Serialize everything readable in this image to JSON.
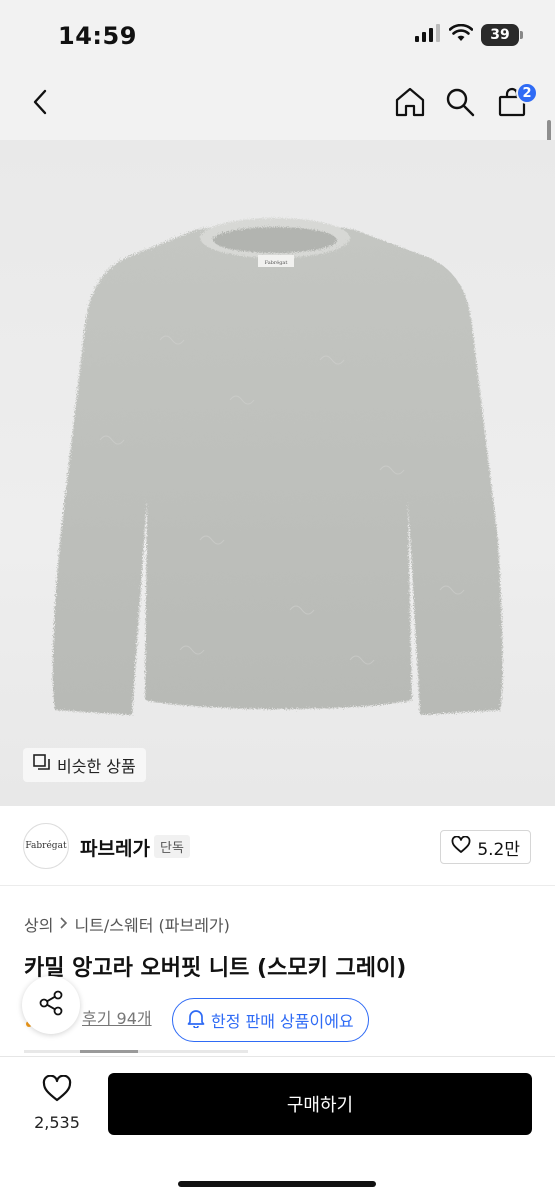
{
  "status_bar": {
    "time": "14:59",
    "battery": "39",
    "icons": [
      "cellular-signal-icon",
      "wifi-icon",
      "battery-icon"
    ]
  },
  "nav": {
    "icons": [
      "back-chevron-icon",
      "home-icon",
      "search-icon",
      "cart-icon"
    ],
    "cart_count": "2"
  },
  "product_image": {
    "label_text": "Fabrégat",
    "similar_button_label": "비슷한 상품"
  },
  "brand": {
    "logo_text": "Fabrégat",
    "name": "파브레가",
    "tag": "단독",
    "likes": "5.2만"
  },
  "breadcrumb": {
    "category": "상의",
    "subcategory": "니트/스웨터 (파브레가)"
  },
  "product": {
    "title": "카밀 앙고라 오버핏 니트 (스모키 그레이)",
    "reviews_link": "후기 94개",
    "limited_notice": "한정 판매 상품이에요"
  },
  "bottom_bar": {
    "wish_count": "2,535",
    "buy_label": "구매하기"
  },
  "colors": {
    "accent_blue": "#2f6bf5",
    "buy_button": "#000000",
    "sweater_gray": "#bfc1bd"
  }
}
